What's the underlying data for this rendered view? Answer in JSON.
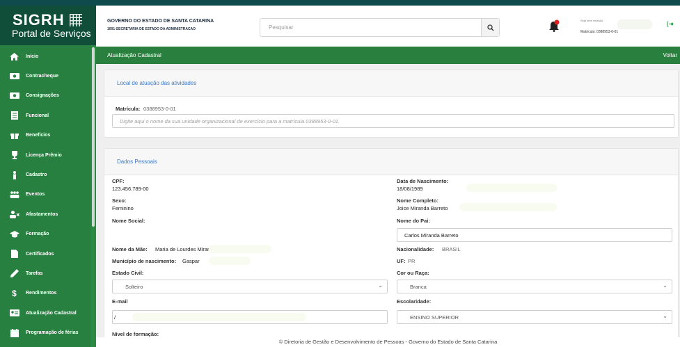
{
  "logo": {
    "title": "SIGRH",
    "subtitle": "Portal de Serviços"
  },
  "header": {
    "org": "GOVERNO DO ESTADO DE SANTA CATARINA",
    "dept": "1001-SECRETARIA DE ESTADO DA ADMINISTRACAO",
    "search_placeholder": "Pesquisar",
    "user_name": "Seja bem vinda(o)",
    "matricula": "Matricula: 0388953-0-01",
    "notification_count": "1"
  },
  "sidebar": {
    "items": [
      {
        "label": "Início",
        "icon": "home-icon"
      },
      {
        "label": "Contracheque",
        "icon": "money-icon"
      },
      {
        "label": "Consignações",
        "icon": "money-icon"
      },
      {
        "label": "Funcional",
        "icon": "document-icon"
      },
      {
        "label": "Benefícios",
        "icon": "gift-icon"
      },
      {
        "label": "Licença Prêmio",
        "icon": "trophy-icon"
      },
      {
        "label": "Cadastro",
        "icon": "person-icon"
      },
      {
        "label": "Eventos",
        "icon": "users-icon"
      },
      {
        "label": "Afastamentos",
        "icon": "user-x-icon"
      },
      {
        "label": "Formação",
        "icon": "graduation-cap-icon"
      },
      {
        "label": "Certificados",
        "icon": "file-icon"
      },
      {
        "label": "Tarefas",
        "icon": "pencil-icon"
      },
      {
        "label": "Rendimentos",
        "icon": "dollar-icon"
      },
      {
        "label": "Atualização Cadastral",
        "icon": "id-card-icon"
      },
      {
        "label": "Programação de férias",
        "icon": "calendar-icon"
      }
    ]
  },
  "page": {
    "title": "Atualização Cadastral",
    "back": "Voltar"
  },
  "local": {
    "section_title": "Local de atuação das atividades",
    "matricula_label": "Matrícula:",
    "matricula_value": "0388953-0-01",
    "unit_placeholder": "Digite aqui o nome da sua unidade organizacional de exercício para a matrícula 0388953-0-01."
  },
  "pessoais": {
    "section_title": "Dados Pessoais",
    "cpf_label": "CPF:",
    "cpf": "123.456.789-00",
    "nasc_label": "Data de Nascimento:",
    "nasc": "18/08/1989",
    "sexo_label": "Sexo:",
    "sexo": "Feminino",
    "nome_label": "Nome Completo:",
    "nome": "Joice Miranda Barreto",
    "social_label": "Nome Social:",
    "pai_label": "Nome do Pai:",
    "pai": "Carlos Miranda Barreto",
    "mae_label": "Nome da Mãe:",
    "mae": "Maria de Lourdes Miranda",
    "nac_label": "Nacionalidade:",
    "nac": "BRASIL",
    "mun_label": "Município de nascimento:",
    "mun": "Gaspar",
    "uf_label": "UF:",
    "uf": "PR",
    "civil_label": "Estado Civil:",
    "civil": "Solteiro",
    "raca_label": "Cor ou Raça:",
    "raca": "Branca",
    "email_label": "E-mail",
    "email": "/",
    "esc_label": "Escolaridade:",
    "esc": "ENSINO SUPERIOR",
    "form_label": "Nível de formação:"
  },
  "footer": "© Diretoria de Gestão e Desenvolvimento de Pessoas - Governo do Estado de Santa Catarina",
  "colors": {
    "sidebar": "#27803f",
    "accent_blue": "#3b79c6",
    "dark_header": "#0f4a4c"
  }
}
